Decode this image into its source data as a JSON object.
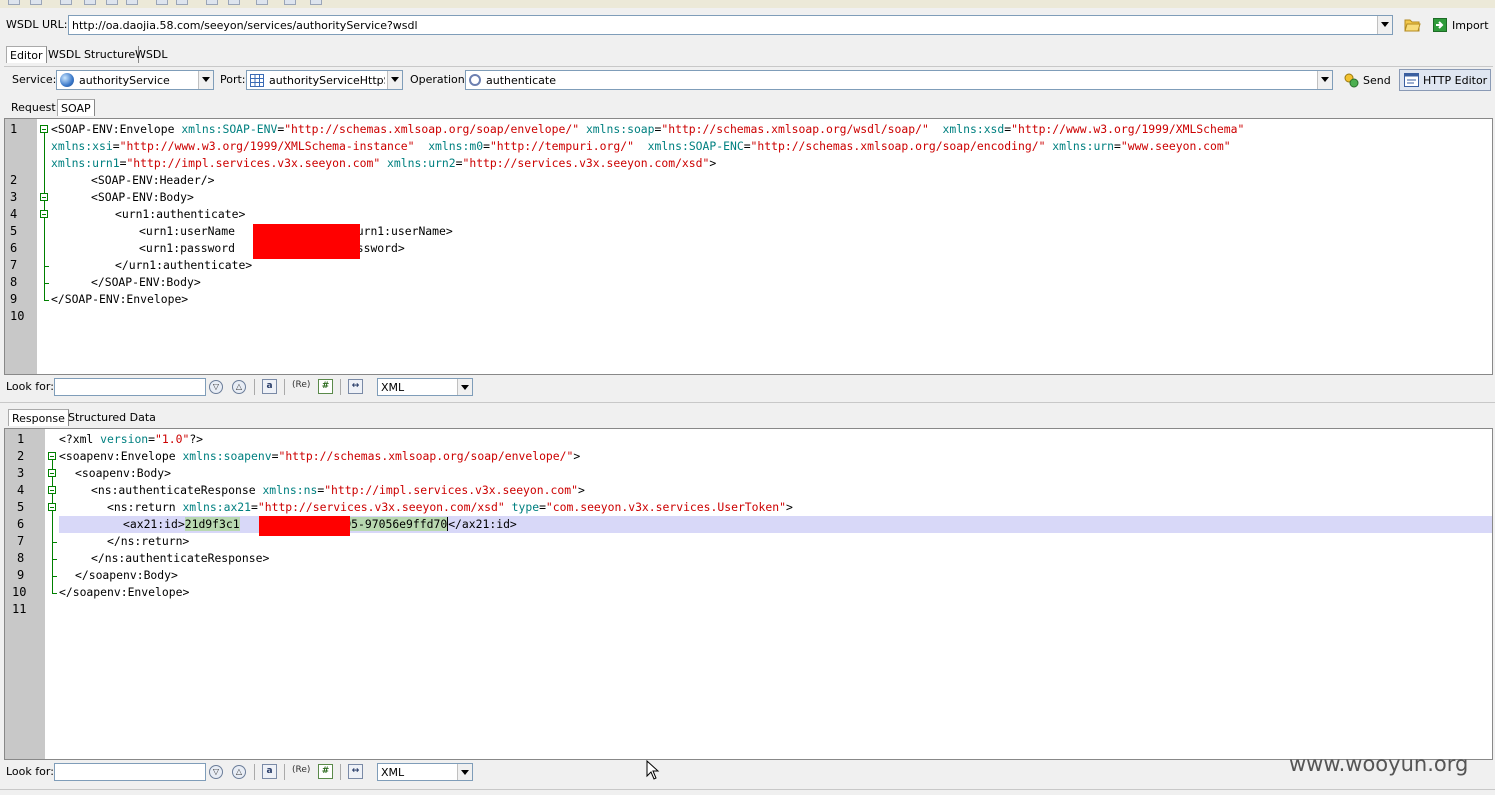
{
  "wsdl": {
    "label": "WSDL URL:",
    "url": "http://oa.daojia.58.com/seeyon/services/authorityService?wsdl",
    "import_label": "Import"
  },
  "main_tabs": [
    "Editor",
    "WSDL Structure",
    "WSDL"
  ],
  "service_bar": {
    "service_label": "Service:",
    "service_value": "authorityService",
    "port_label": "Port:",
    "port_value": "authorityServiceHttpSoa",
    "operation_label": "Operation:",
    "operation_value": "authenticate",
    "send_label": "Send",
    "http_editor_label": "HTTP Editor"
  },
  "request_tabs": [
    "Request",
    "SOAP"
  ],
  "response_tabs": [
    "Response",
    "Structured Data"
  ],
  "request_lines": [
    "1",
    "2",
    "3",
    "4",
    "5",
    "6",
    "7",
    "8",
    "9",
    "10"
  ],
  "response_lines": [
    "1",
    "2",
    "3",
    "4",
    "5",
    "6",
    "7",
    "8",
    "9",
    "10",
    "11"
  ],
  "request_code": {
    "l1a": "<SOAP-ENV:Envelope ",
    "l1b_n": "xmlns:SOAP-ENV",
    "l1b_v": "\"http://schemas.xmlsoap.org/soap/envelope/\"",
    "l1c_n": "xmlns:soap",
    "l1c_v": "\"http://schemas.xmlsoap.org/wsdl/soap/\"",
    "l1d_n": "xmlns:xsd",
    "l1d_v": "\"http://www.w3.org/1999/XMLSchema\"",
    "l1e_n": "xmlns:xsi",
    "l1e_v": "\"http://www.w3.org/1999/XMLSchema-instance\"",
    "l1f_n": "xmlns:m0",
    "l1f_v": "\"http://tempuri.org/\"",
    "l1g_n": "xmlns:SOAP-ENC",
    "l1g_v": "\"http://schemas.xmlsoap.org/soap/encoding/\"",
    "l1h_n": "xmlns:urn",
    "l1h_v": "\"www.seeyon.com\"",
    "l1i_n": "xmlns:urn1",
    "l1i_v": "\"http://impl.services.v3x.seeyon.com\"",
    "l1j_n": "xmlns:urn2",
    "l1j_v": "\"http://services.v3x.seeyon.com/xsd\"",
    "l2": "<SOAP-ENV:Header/>",
    "l3": "<SOAP-ENV:Body>",
    "l4": "<urn1:authenticate>",
    "l5a": "<urn1:userName",
    "l5b": "</urn1:userName>",
    "l6a": "<urn1:password",
    "l6b": "password>",
    "l7": "</urn1:authenticate>",
    "l8": "</SOAP-ENV:Body>",
    "l9": "</SOAP-ENV:Envelope>"
  },
  "response_code": {
    "l1a": "<?xml ",
    "l1n": "version",
    "l1v": "\"1.0\"",
    "l1e": "?>",
    "l2a": "<soapenv:Envelope ",
    "l2n": "xmlns:soapenv",
    "l2v": "\"http://schemas.xmlsoap.org/soap/envelope/\"",
    "l3": "<soapenv:Body>",
    "l4a": "<ns:authenticateResponse ",
    "l4n": "xmlns:ns",
    "l4v": "\"http://impl.services.v3x.seeyon.com\"",
    "l5a": "<ns:return ",
    "l5n1": "xmlns:ax21",
    "l5v1": "\"http://services.v3x.seeyon.com/xsd\"",
    "l5n2": "type",
    "l5v2": "\"com.seeyon.v3x.services.UserToken\"",
    "l6a": "<ax21:id>",
    "l6v1": "21d9f3c1",
    "l6v2": "bf95-97056e9ffd70",
    "l6b": "</ax21:id>",
    "l7": "</ns:return>",
    "l8": "</ns:authenticateResponse>",
    "l9": "</soapenv:Body>",
    "l10": "</soapenv:Envelope>"
  },
  "search": {
    "label": "Look for:",
    "value": "",
    "format": "XML"
  },
  "watermark": "www.wooyun.org"
}
